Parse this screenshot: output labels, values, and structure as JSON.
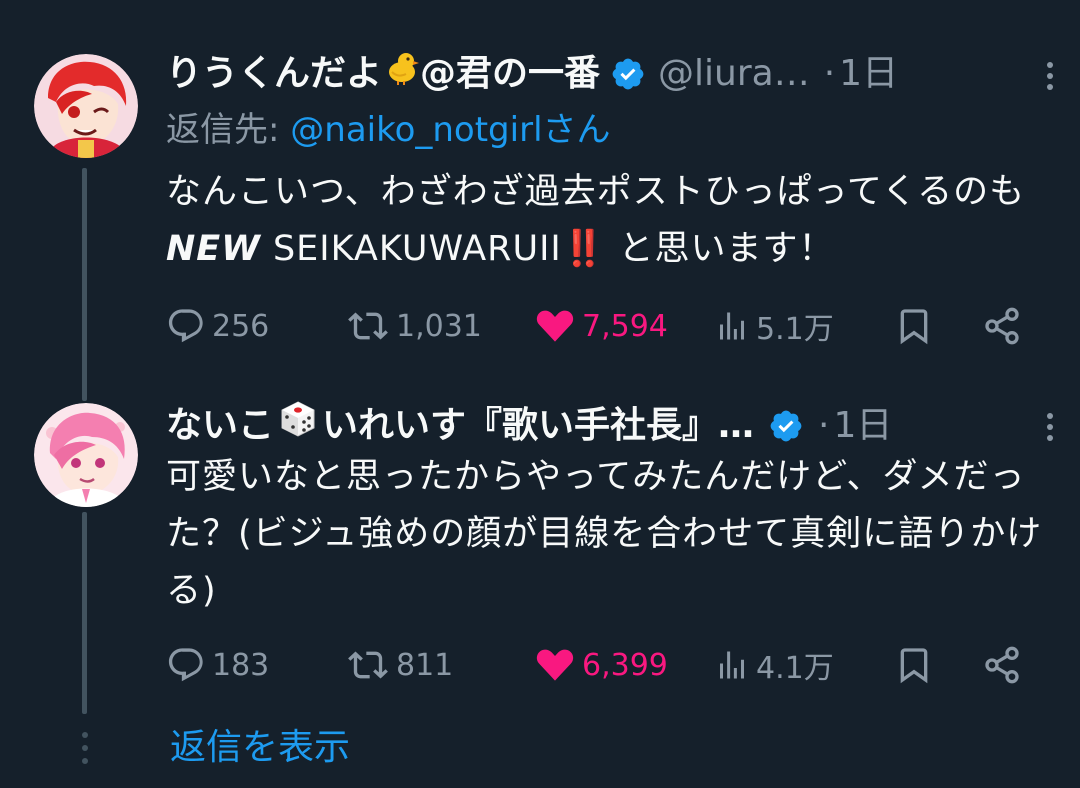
{
  "tweets": [
    {
      "name_text": "りうくんだよ",
      "name_suffix": "@君の一番",
      "name_emoji": "chick-emoji",
      "handle": "@liura…",
      "dot": "·",
      "time": "1日",
      "reply_prefix": "返信先: ",
      "reply_mention": "@naiko_notgirl",
      "reply_suffix": "さん",
      "body_part1": "なんこいつ、わざわざ過去ポストひっぱってくるのも",
      "body_bold": "NEW",
      "body_part2": " SEIKAKUWARUII",
      "body_emoji": "‼️",
      "body_part3": " と思います！",
      "replies": "256",
      "reposts": "1,031",
      "likes": "7,594",
      "views": "5.1万"
    },
    {
      "name_text": "ないこ",
      "name_suffix": "いれいす『歌い手社長』…",
      "name_emoji": "dice-emoji",
      "dot": "·",
      "time": "1日",
      "body": "可愛いなと思ったからやってみたんだけど、ダメだった？(ビジュ強めの顔が目線を合わせて真剣に語りかける)",
      "replies": "183",
      "reposts": "811",
      "likes": "6,399",
      "views": "4.1万"
    }
  ],
  "show_replies": "返信を表示",
  "colors": {
    "background": "#15202b",
    "text": "#f7f9f9",
    "secondary": "#8b98a5",
    "link": "#1d9bf0",
    "like": "#f91880",
    "thread_line": "#42535f"
  }
}
